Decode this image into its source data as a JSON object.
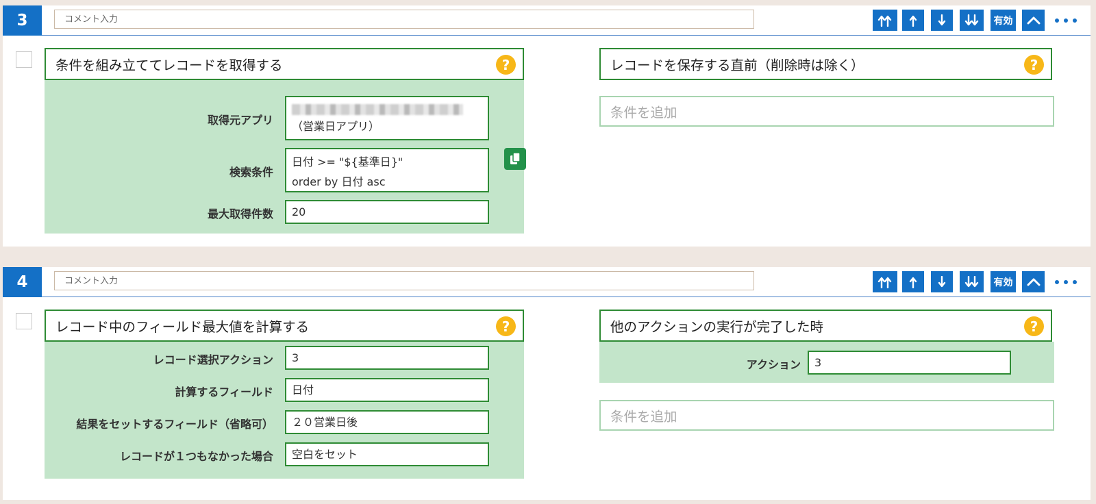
{
  "toolbar": {
    "move_top_icon": "double-up-arrow-icon",
    "move_up_icon": "up-arrow-icon",
    "move_down_icon": "down-arrow-icon",
    "move_bottom_icon": "double-down-arrow-icon",
    "enabled_label": "有効",
    "collapse_icon": "chevron-up-icon",
    "more_icon": "more-dots-icon"
  },
  "colors": {
    "accent_blue": "#1470c6",
    "action_green": "#2e8b34",
    "panel_green": "#c3e5ca",
    "help_yellow": "#f7b718",
    "copy_green": "#23914a"
  },
  "blocks": [
    {
      "number": "3",
      "comment_placeholder": "コメント入力",
      "action": {
        "title": "条件を組み立ててレコードを取得する",
        "fields": [
          {
            "label": "取得元アプリ",
            "value_line1": "",
            "value_line2": "（営業日アプリ）"
          },
          {
            "label": "検索条件",
            "value_line1": "日付 >= \"${基準日}\"",
            "value_line2": "order by 日付 asc"
          },
          {
            "label": "最大取得件数",
            "value": "20"
          }
        ]
      },
      "trigger": {
        "title": "レコードを保存する直前（削除時は除く）",
        "add_condition": "条件を追加"
      }
    },
    {
      "number": "4",
      "comment_placeholder": "コメント入力",
      "action": {
        "title": "レコード中のフィールド最大値を計算する",
        "fields": [
          {
            "label": "レコード選択アクション",
            "value": "3"
          },
          {
            "label": "計算するフィールド",
            "value": "日付"
          },
          {
            "label": "結果をセットするフィールド（省略可）",
            "value": "２０営業日後"
          },
          {
            "label": "レコードが１つもなかった場合",
            "value": "空白をセット"
          }
        ]
      },
      "trigger": {
        "title": "他のアクションの実行が完了した時",
        "fields": [
          {
            "label": "アクション",
            "value": "3"
          }
        ],
        "add_condition": "条件を追加"
      }
    }
  ]
}
